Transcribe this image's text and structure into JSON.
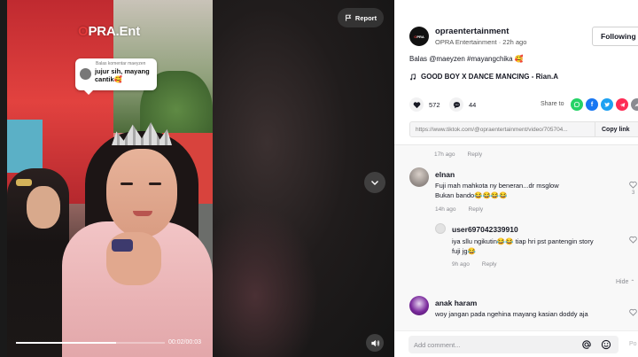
{
  "video": {
    "brand_prefix": "O",
    "brand_rest": "PRA.Ent",
    "reply_card": {
      "header": "Balas komentar maeyzen",
      "text": "jujur sih, mayang cantik🥰"
    },
    "report_label": "Report",
    "time": "00:02/00:03",
    "progress": 0.67
  },
  "author": {
    "username": "opraentertainment",
    "display_line": "OPRA Entertainment · 22h ago",
    "follow_label": "Following"
  },
  "caption": "Balas @maeyzen #mayangchika 🥰",
  "music": "GOOD BOY X DANCE MANCING - Rian.A",
  "stats": {
    "likes": "572",
    "comments": "44"
  },
  "share": {
    "label": "Share to",
    "icons": [
      "whatsapp-icon",
      "facebook-icon",
      "twitter-icon",
      "telegram-icon",
      "share-more-icon"
    ]
  },
  "link": {
    "url": "https://www.tiktok.com/@opraentertainment/video/705704...",
    "copy_label": "Copy link"
  },
  "comments": {
    "first_meta": {
      "time": "17h ago",
      "reply": "Reply"
    },
    "items": [
      {
        "name": "elnan",
        "text_line1": "Fuji mah mahkota ny beneran...dr msglow",
        "text_line2": "Bukan bando😂😂😂😂",
        "time": "14h ago",
        "reply": "Reply",
        "likes": "3"
      },
      {
        "name": "user697042339910",
        "text_line1": "iya sllu ngikutin😂😂 tiap hri pst pantengin story",
        "text_line2": "fuji jg😂",
        "time": "9h ago",
        "reply": "Reply"
      },
      {
        "name": "anak haram",
        "text_line1": "woy jangan pada ngehina mayang kasian doddy aja"
      }
    ],
    "hide_label": "Hide"
  },
  "input": {
    "placeholder": "Add comment...",
    "post_label": "Po"
  },
  "colors": {
    "accent": "#fe2c55",
    "brand_red": "#e43a3a",
    "whatsapp": "#25d366",
    "facebook": "#1877f2",
    "twitter": "#1da1f2",
    "telegram": "#fe2c55"
  }
}
